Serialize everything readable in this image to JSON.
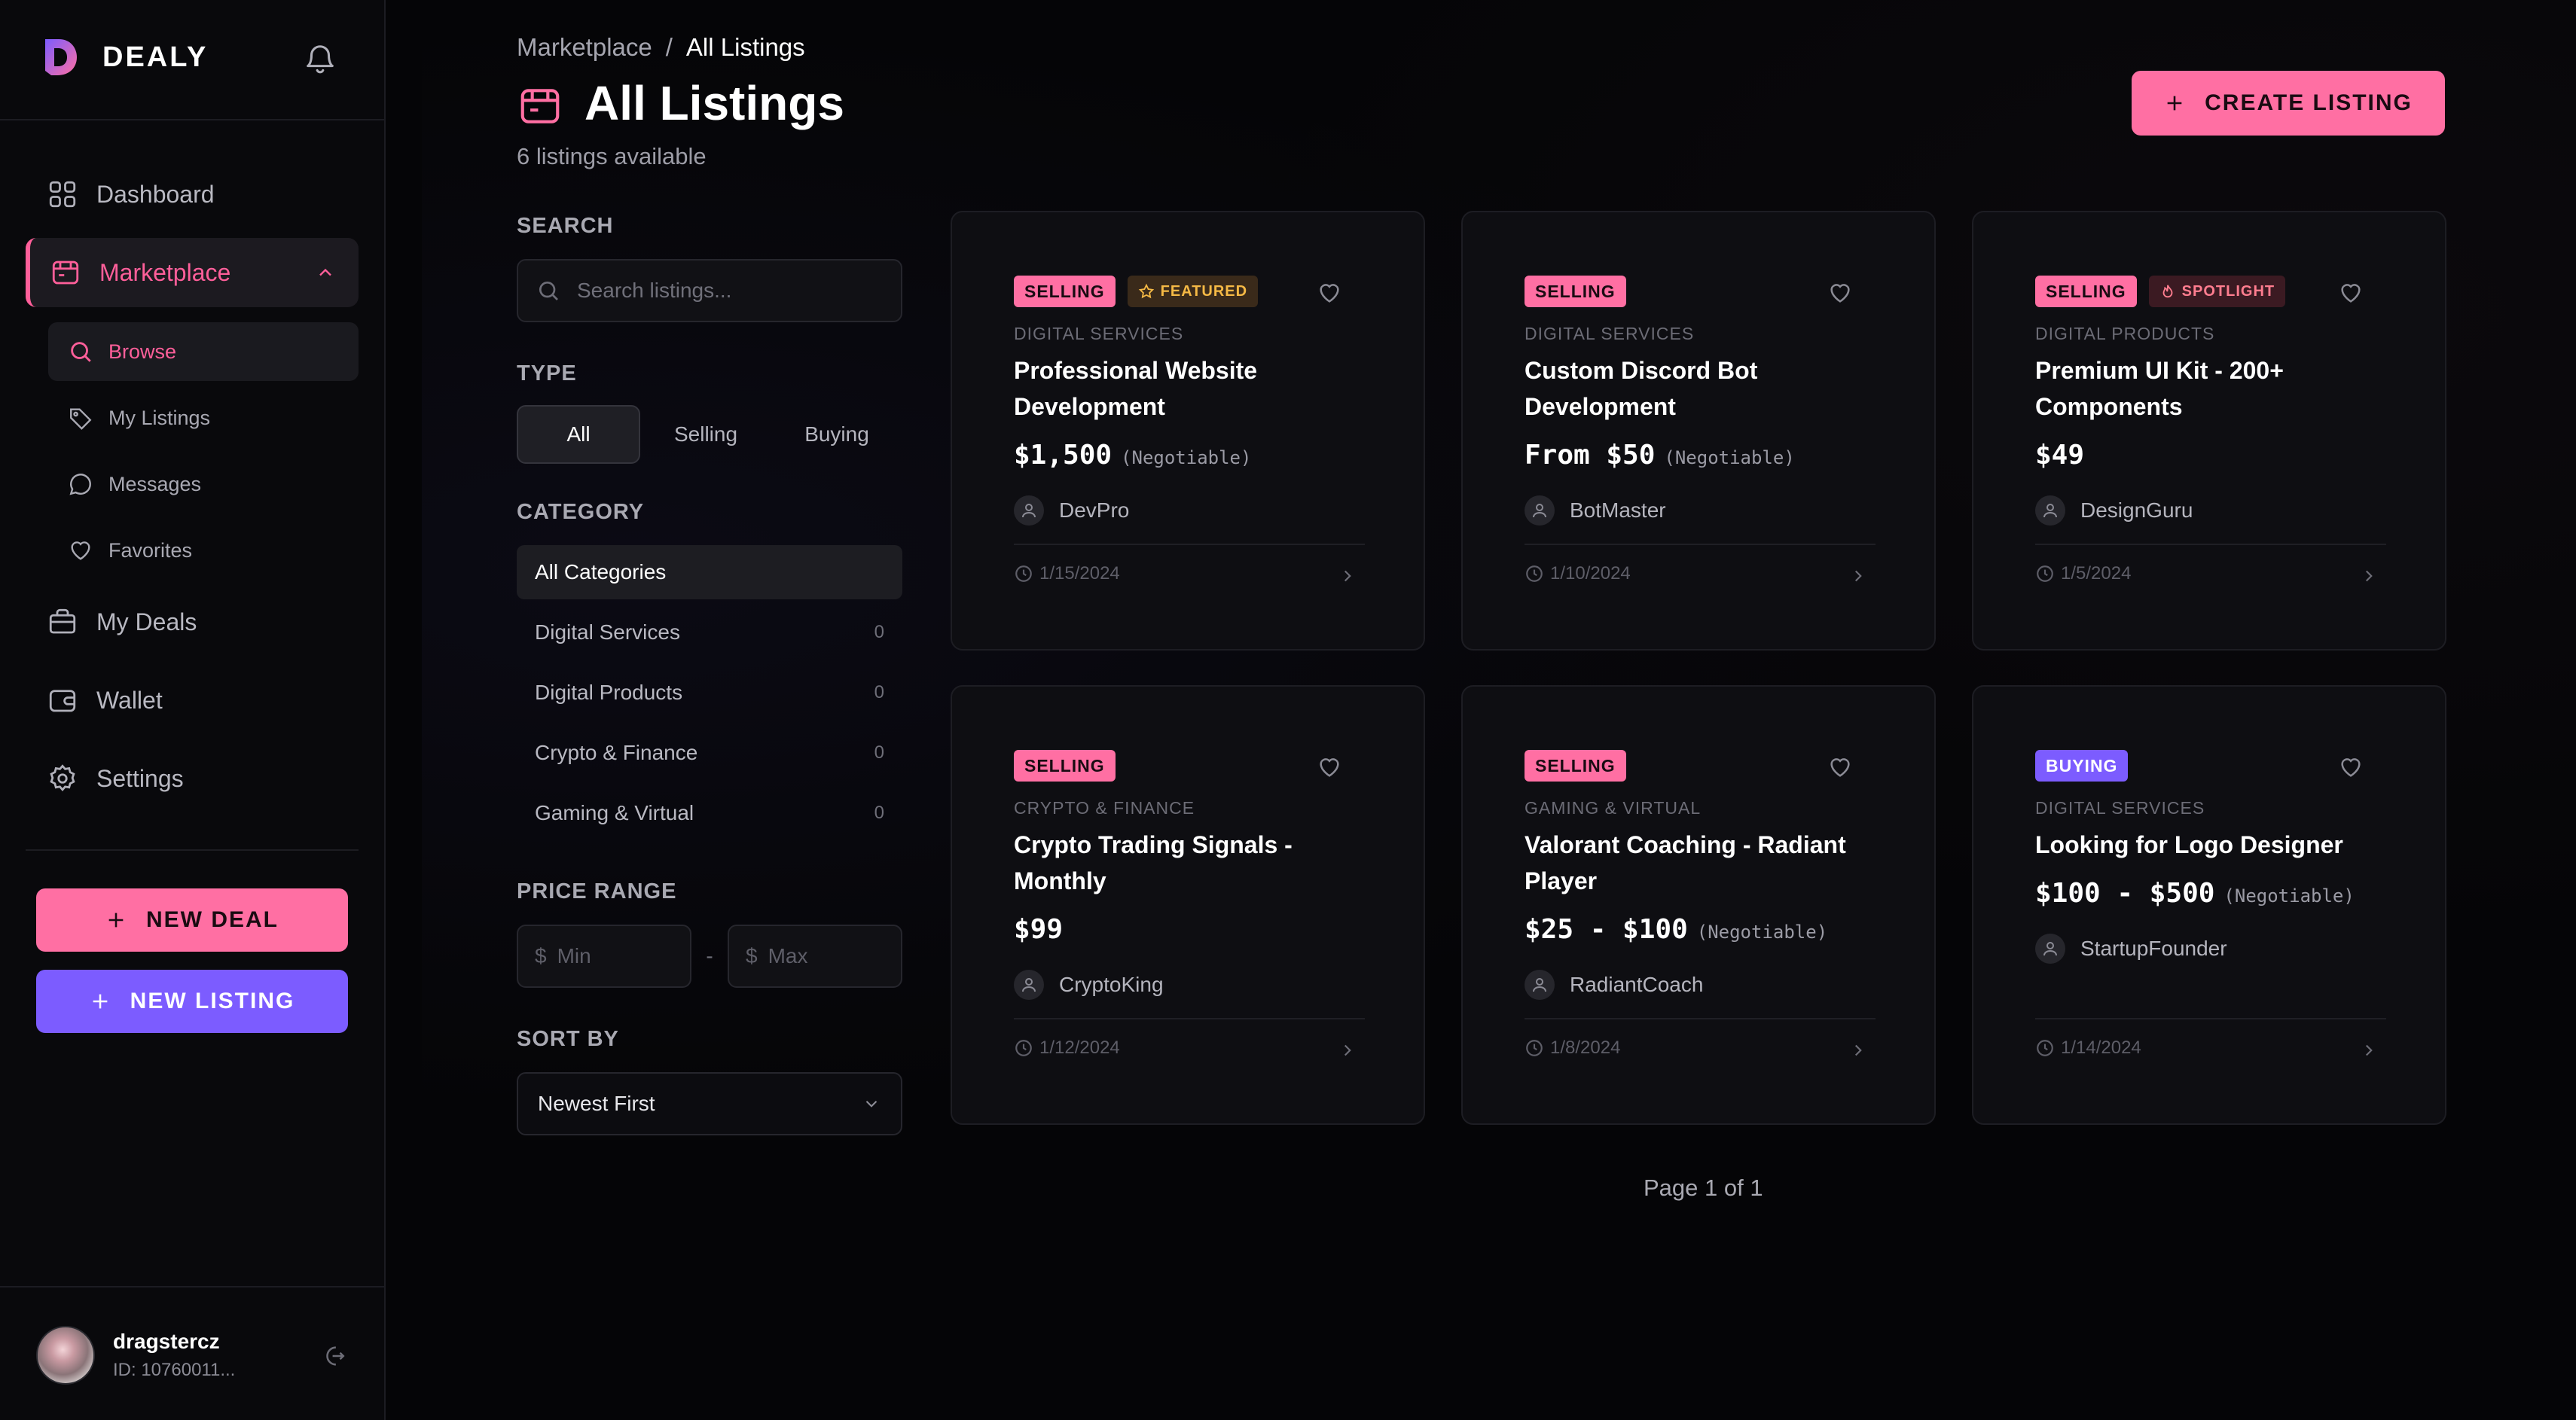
{
  "brand": {
    "name": "DEALY"
  },
  "colors": {
    "accent_pink": "#ff6fa3",
    "accent_purple": "#7c5cff",
    "background": "#050507"
  },
  "sidebar": {
    "nav": [
      {
        "label": "Dashboard",
        "icon": "grid-icon"
      },
      {
        "label": "Marketplace",
        "icon": "store-icon"
      },
      {
        "label": "My Deals",
        "icon": "briefcase-icon"
      },
      {
        "label": "Wallet",
        "icon": "wallet-icon"
      },
      {
        "label": "Settings",
        "icon": "gear-icon"
      }
    ],
    "sub": [
      {
        "label": "Browse",
        "icon": "search-icon"
      },
      {
        "label": "My Listings",
        "icon": "tag-icon"
      },
      {
        "label": "Messages",
        "icon": "chat-icon"
      },
      {
        "label": "Favorites",
        "icon": "heart-icon"
      }
    ],
    "new_deal": "NEW DEAL",
    "new_listing": "NEW LISTING",
    "user": {
      "name": "dragstercz",
      "id": "ID: 10760011..."
    }
  },
  "header": {
    "breadcrumb": {
      "parent": "Marketplace",
      "sep": "/",
      "current": "All Listings"
    },
    "title": "All Listings",
    "subtitle": "6 listings available",
    "create_label": "CREATE LISTING"
  },
  "filters": {
    "search_label": "SEARCH",
    "search_placeholder": "Search listings...",
    "type_label": "TYPE",
    "types": [
      "All",
      "Selling",
      "Buying"
    ],
    "category_label": "CATEGORY",
    "categories": [
      {
        "name": "All Categories",
        "count": ""
      },
      {
        "name": "Digital Services",
        "count": "0"
      },
      {
        "name": "Digital Products",
        "count": "0"
      },
      {
        "name": "Crypto & Finance",
        "count": "0"
      },
      {
        "name": "Gaming & Virtual",
        "count": "0"
      }
    ],
    "price_label": "PRICE RANGE",
    "currency": "$",
    "min_placeholder": "Min",
    "max_placeholder": "Max",
    "price_sep": "-",
    "sort_label": "SORT BY",
    "sort_value": "Newest First"
  },
  "listings": [
    {
      "type": "SELLING",
      "badge": "FEATURED",
      "category": "DIGITAL SERVICES",
      "title": "Professional Website Development",
      "price": "$1,500",
      "negotiable": "(Negotiable)",
      "seller": "DevPro",
      "date": "1/15/2024"
    },
    {
      "type": "SELLING",
      "badge": "",
      "category": "DIGITAL SERVICES",
      "title": "Custom Discord Bot Development",
      "price": "From $50",
      "negotiable": "(Negotiable)",
      "seller": "BotMaster",
      "date": "1/10/2024"
    },
    {
      "type": "SELLING",
      "badge": "SPOTLIGHT",
      "category": "DIGITAL PRODUCTS",
      "title": "Premium UI Kit - 200+ Components",
      "price": "$49",
      "negotiable": "",
      "seller": "DesignGuru",
      "date": "1/5/2024"
    },
    {
      "type": "SELLING",
      "badge": "",
      "category": "CRYPTO & FINANCE",
      "title": "Crypto Trading Signals - Monthly",
      "price": "$99",
      "negotiable": "",
      "seller": "CryptoKing",
      "date": "1/12/2024"
    },
    {
      "type": "SELLING",
      "badge": "",
      "category": "GAMING & VIRTUAL",
      "title": "Valorant Coaching - Radiant Player",
      "price": "$25 - $100",
      "negotiable": "(Negotiable)",
      "seller": "RadiantCoach",
      "date": "1/8/2024"
    },
    {
      "type": "BUYING",
      "badge": "",
      "category": "DIGITAL SERVICES",
      "title": "Looking for Logo Designer",
      "price": "$100 - $500",
      "negotiable": "(Negotiable)",
      "seller": "StartupFounder",
      "date": "1/14/2024"
    }
  ],
  "pagination": {
    "text": "Page 1 of 1"
  }
}
